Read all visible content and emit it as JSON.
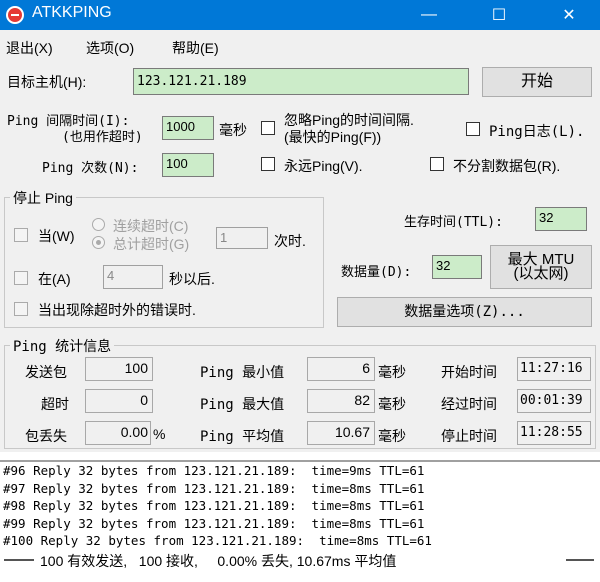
{
  "window": {
    "title": "ATKKPING",
    "minimize": "—",
    "maximize": "☐",
    "close": "✕"
  },
  "menu": {
    "exit": "退出(X)",
    "options": "选项(O)",
    "help": "帮助(E)"
  },
  "target": {
    "label": "目标主机(H):",
    "value": "123.121.21.189",
    "start_button": "开始"
  },
  "interval": {
    "label_line1": "Ping 间隔时间(I):",
    "label_line2": "(也用作超时)",
    "value": "1000",
    "unit": "毫秒"
  },
  "ignore_interval": {
    "line1": "忽略Ping的时间间隔.",
    "line2": "(最快的Ping(F))"
  },
  "ping_log": {
    "label": "Ping日志(L)."
  },
  "count": {
    "label": "Ping 次数(N):",
    "value": "100"
  },
  "forever": {
    "label": "永远Ping(V)."
  },
  "no_fragment": {
    "label": "不分割数据包(R)."
  },
  "stop_group": {
    "title": "停止 Ping",
    "when": "当(W)",
    "consecutive_timeout": "连续超时(C)",
    "total_timeout": "总计超时(G)",
    "times_value": "1",
    "times_unit": "次时.",
    "at": "在(A)",
    "seconds_value": "4",
    "seconds_unit": "秒以后.",
    "on_error": "当出现除超时外的错误时."
  },
  "ttl": {
    "label": "生存时间(TTL):",
    "value": "32"
  },
  "data_size": {
    "label": "数据量(D):",
    "value": "32",
    "mtu_line1": "最大 MTU",
    "mtu_line2": "(以太网)"
  },
  "data_options_button": "数据量选项(Z)...",
  "stats": {
    "title": "Ping  统计信息",
    "sent_label": "发送包",
    "sent_value": "100",
    "timeout_label": "超时",
    "timeout_value": "0",
    "loss_label": "包丢失",
    "loss_value": "0.00",
    "loss_unit": "%",
    "min_label": "Ping 最小值",
    "min_value": "6",
    "min_unit": "毫秒",
    "max_label": "Ping 最大值",
    "max_value": "82",
    "max_unit": "毫秒",
    "avg_label": "Ping 平均值",
    "avg_value": "10.67",
    "avg_unit": "毫秒",
    "start_label": "开始时间",
    "start_value": "11:27:16",
    "elapsed_label": "经过时间",
    "elapsed_value": "00:01:39",
    "stop_label": "停止时间",
    "stop_value": "11:28:55"
  },
  "log": [
    "#96 Reply 32 bytes from 123.121.21.189:  time=9ms TTL=61",
    "#97 Reply 32 bytes from 123.121.21.189:  time=8ms TTL=61",
    "#98 Reply 32 bytes from 123.121.21.189:  time=8ms TTL=61",
    "#99 Reply 32 bytes from 123.121.21.189:  time=8ms TTL=61",
    "#100 Reply 32 bytes from 123.121.21.189:  time=8ms TTL=61"
  ],
  "summary": "100 有效发送,   100 接收,     0.00% 丢失, 10.67ms 平均值"
}
